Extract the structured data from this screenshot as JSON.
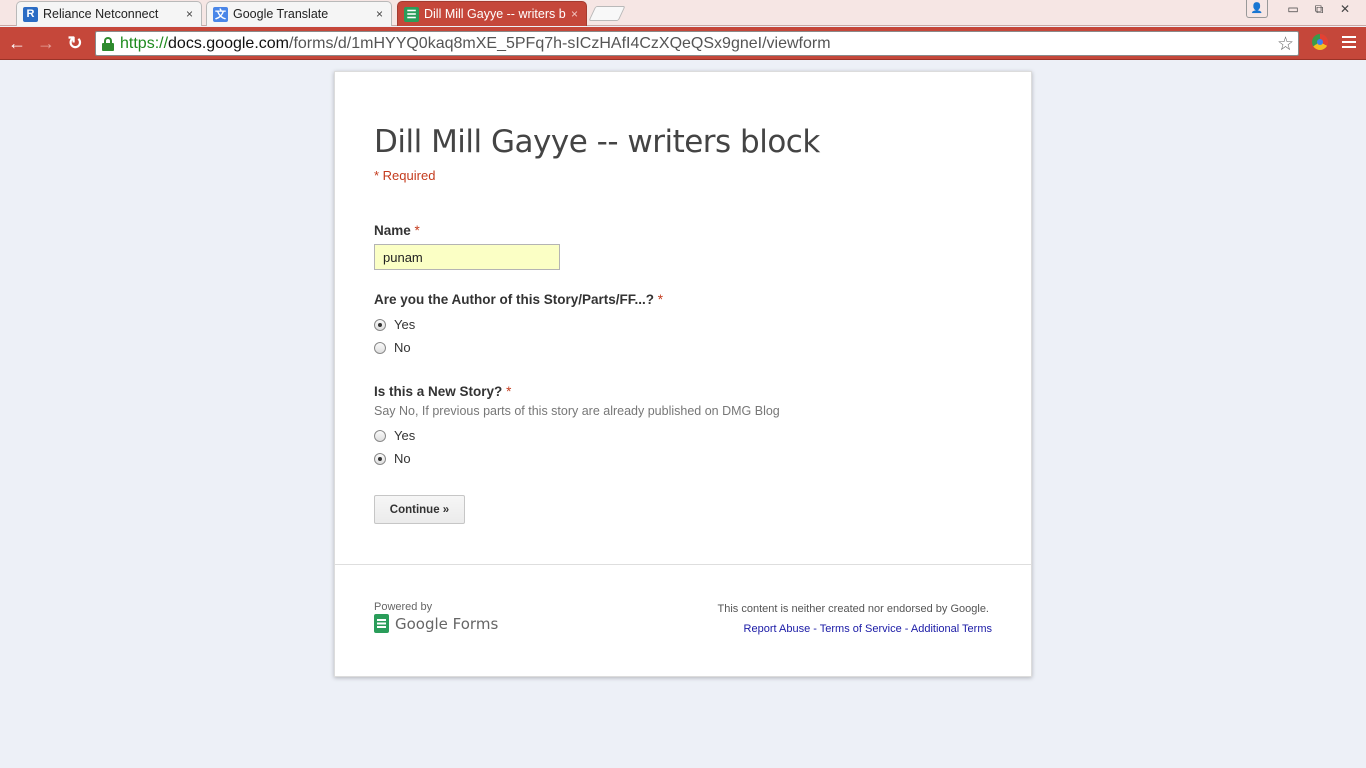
{
  "tabs": [
    {
      "title": "Reliance Netconnect",
      "icon": "reliance-favicon",
      "active": false,
      "close": "×"
    },
    {
      "title": "Google Translate",
      "icon": "google-translate-favicon",
      "active": false,
      "close": "×"
    },
    {
      "title": "Dill Mill Gayye -- writers b",
      "icon": "google-forms-favicon",
      "active": true,
      "close": "×"
    }
  ],
  "window_controls": {
    "minimize": "▭",
    "restore": "⧉",
    "close": "✕"
  },
  "toolbar": {
    "url_scheme": "https://",
    "url_host": "docs.google.com",
    "url_path": "/forms/d/1mHYYQ0kaq8mXE_5PFq7h-sICzHAfI4CzXQeQSx9gneI/viewform"
  },
  "form": {
    "title": "Dill Mill Gayye -- writers block",
    "required_note": "* Required",
    "questions": [
      {
        "label": "Name",
        "required_mark": "*",
        "type": "text",
        "value": "punam"
      },
      {
        "label": "Are you the Author of this Story/Parts/FF...?",
        "required_mark": "*",
        "type": "radio",
        "options": [
          {
            "label": "Yes",
            "checked": true
          },
          {
            "label": "No",
            "checked": false
          }
        ]
      },
      {
        "label": "Is this a New Story?",
        "required_mark": "*",
        "type": "radio",
        "help": "Say No, If previous parts of this story are already published on DMG Blog",
        "options": [
          {
            "label": "Yes",
            "checked": false
          },
          {
            "label": "No",
            "checked": true
          }
        ]
      }
    ],
    "continue_label": "Continue »"
  },
  "footer": {
    "powered_by": "Powered by",
    "logo_text": "Google Forms",
    "disclaimer": "This content is neither created nor endorsed by Google.",
    "links": [
      "Report Abuse",
      "Terms of Service",
      "Additional Terms"
    ],
    "link_separator": " - "
  },
  "colors": {
    "chrome_accent": "#c5473a",
    "required": "#c43b1d",
    "input_highlight": "#fbffc5",
    "forms_green": "#2a9d5a",
    "link": "#1a1aa6"
  }
}
